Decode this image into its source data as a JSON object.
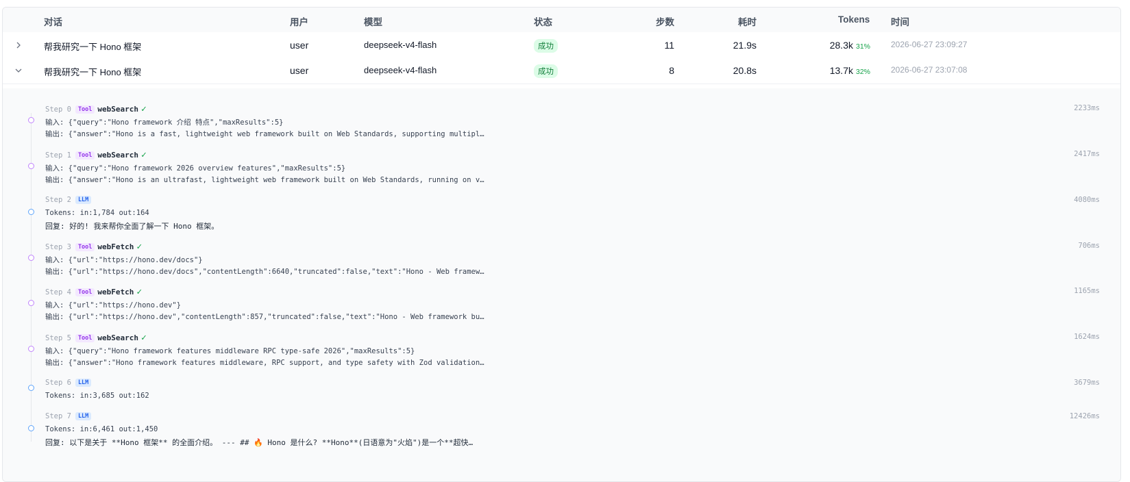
{
  "header": {
    "conversation": "对话",
    "user": "用户",
    "model": "模型",
    "status": "状态",
    "steps": "步数",
    "duration": "耗时",
    "tokens": "Tokens",
    "time": "时间"
  },
  "rows": [
    {
      "title": "帮我研究一下 Hono 框架",
      "user": "user",
      "model": "deepseek-v4-flash",
      "status": "成功",
      "steps": "11",
      "duration": "21.9s",
      "tokens": "28.3k",
      "pct": "31%",
      "time": "2026-06-27 23:09:27",
      "expanded": false
    },
    {
      "title": "帮我研究一下 Hono 框架",
      "user": "user",
      "model": "deepseek-v4-flash",
      "status": "成功",
      "steps": "8",
      "duration": "20.8s",
      "tokens": "13.7k",
      "pct": "32%",
      "time": "2026-06-27 23:07:08",
      "expanded": true
    }
  ],
  "steps": [
    {
      "label": "Step 0",
      "kind": "Tool",
      "name": "webSearch",
      "check": "✓",
      "duration": "2233ms",
      "lines": [
        "输入: {\"query\":\"Hono framework 介绍 特点\",\"maxResults\":5}",
        "输出: {\"answer\":\"Hono is a fast, lightweight web framework built on Web Standards, supporting multipl…"
      ]
    },
    {
      "label": "Step 1",
      "kind": "Tool",
      "name": "webSearch",
      "check": "✓",
      "duration": "2417ms",
      "lines": [
        "输入: {\"query\":\"Hono framework 2026 overview features\",\"maxResults\":5}",
        "输出: {\"answer\":\"Hono is an ultrafast, lightweight web framework built on Web Standards, running on v…"
      ]
    },
    {
      "label": "Step 2",
      "kind": "LLM",
      "name": "",
      "check": "",
      "duration": "4080ms",
      "lines": [
        "Tokens: in:1,784 out:164",
        "回复: 好的! 我来帮你全面了解一下 Hono 框架。"
      ]
    },
    {
      "label": "Step 3",
      "kind": "Tool",
      "name": "webFetch",
      "check": "✓",
      "duration": "706ms",
      "lines": [
        "输入: {\"url\":\"https://hono.dev/docs\"}",
        "输出: {\"url\":\"https://hono.dev/docs\",\"contentLength\":6640,\"truncated\":false,\"text\":\"Hono - Web framew…"
      ]
    },
    {
      "label": "Step 4",
      "kind": "Tool",
      "name": "webFetch",
      "check": "✓",
      "duration": "1165ms",
      "lines": [
        "输入: {\"url\":\"https://hono.dev\"}",
        "输出: {\"url\":\"https://hono.dev\",\"contentLength\":857,\"truncated\":false,\"text\":\"Hono - Web framework bu…"
      ]
    },
    {
      "label": "Step 5",
      "kind": "Tool",
      "name": "webSearch",
      "check": "✓",
      "duration": "1624ms",
      "lines": [
        "输入: {\"query\":\"Hono framework features middleware RPC type-safe 2026\",\"maxResults\":5}",
        "输出: {\"answer\":\"Hono framework features middleware, RPC support, and type safety with Zod validation…"
      ]
    },
    {
      "label": "Step 6",
      "kind": "LLM",
      "name": "",
      "check": "",
      "duration": "3679ms",
      "lines": [
        "Tokens: in:3,685 out:162"
      ]
    },
    {
      "label": "Step 7",
      "kind": "LLM",
      "name": "",
      "check": "",
      "duration": "12426ms",
      "lines": [
        "Tokens: in:6,461 out:1,450",
        "回复: 以下是关于 **Hono 框架** 的全面介绍。 --- ## 🔥 Hono 是什么? **Hono**(日语意为\"火焰\")是一个**超快…"
      ]
    }
  ]
}
